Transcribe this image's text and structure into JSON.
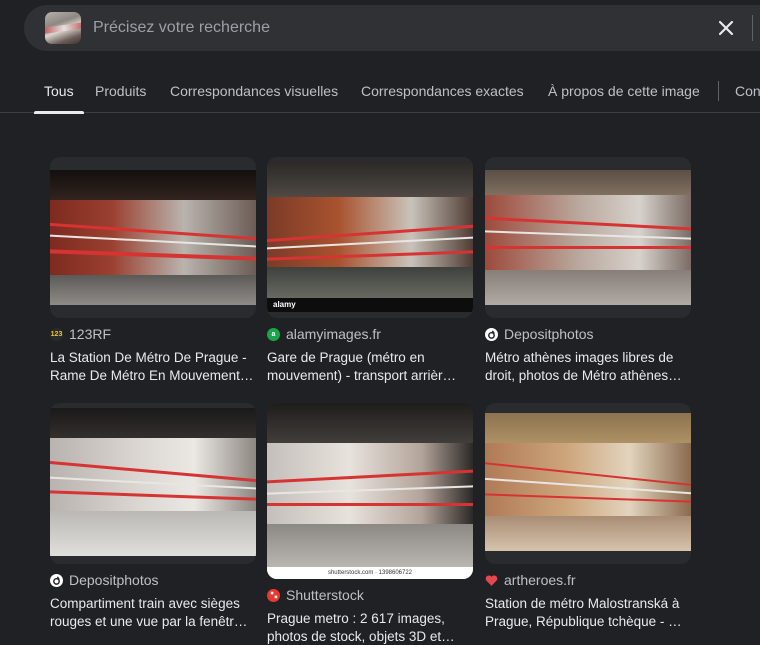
{
  "search": {
    "placeholder": "Précisez votre recherche"
  },
  "tabs": [
    {
      "label": "Tous",
      "active": true
    },
    {
      "label": "Produits"
    },
    {
      "label": "Correspondances visuelles"
    },
    {
      "label": "Correspondances exactes"
    },
    {
      "label": "À propos de cette image"
    },
    {
      "label": "Con"
    }
  ],
  "results": [
    {
      "source": "123RF",
      "favicon": "123rf-favicon",
      "favicon_text": "123",
      "title": "La Station De Métro De Prague - Rame De Métro En Mouvement…"
    },
    {
      "source": "alamyimages.fr",
      "favicon": "alamy-favicon",
      "favicon_text": "a",
      "title": "Gare de Prague (métro en mouvement) - transport arrièr…",
      "watermark": "alamy"
    },
    {
      "source": "Depositphotos",
      "favicon": "depositphotos-favicon",
      "title": "Métro athènes images libres de droit, photos de Métro athènes…"
    },
    {
      "source": "Depositphotos",
      "favicon": "depositphotos-favicon",
      "title": "Compartiment train avec sièges rouges et une vue par la fenêtr…"
    },
    {
      "source": "Shutterstock",
      "favicon": "shutterstock-favicon",
      "title": "Prague metro : 2 617 images, photos de stock, objets 3D et…",
      "watermark": "shutterstock.com · 1398606722"
    },
    {
      "source": "artheroes.fr",
      "favicon": "artheroes-favicon",
      "title": "Station de métro Malostranská à Prague, République tchèque - …"
    }
  ],
  "colors": {
    "background": "#202124",
    "searchbar": "#303134",
    "text": "#e8eaed",
    "muted": "#bdc1c6"
  }
}
